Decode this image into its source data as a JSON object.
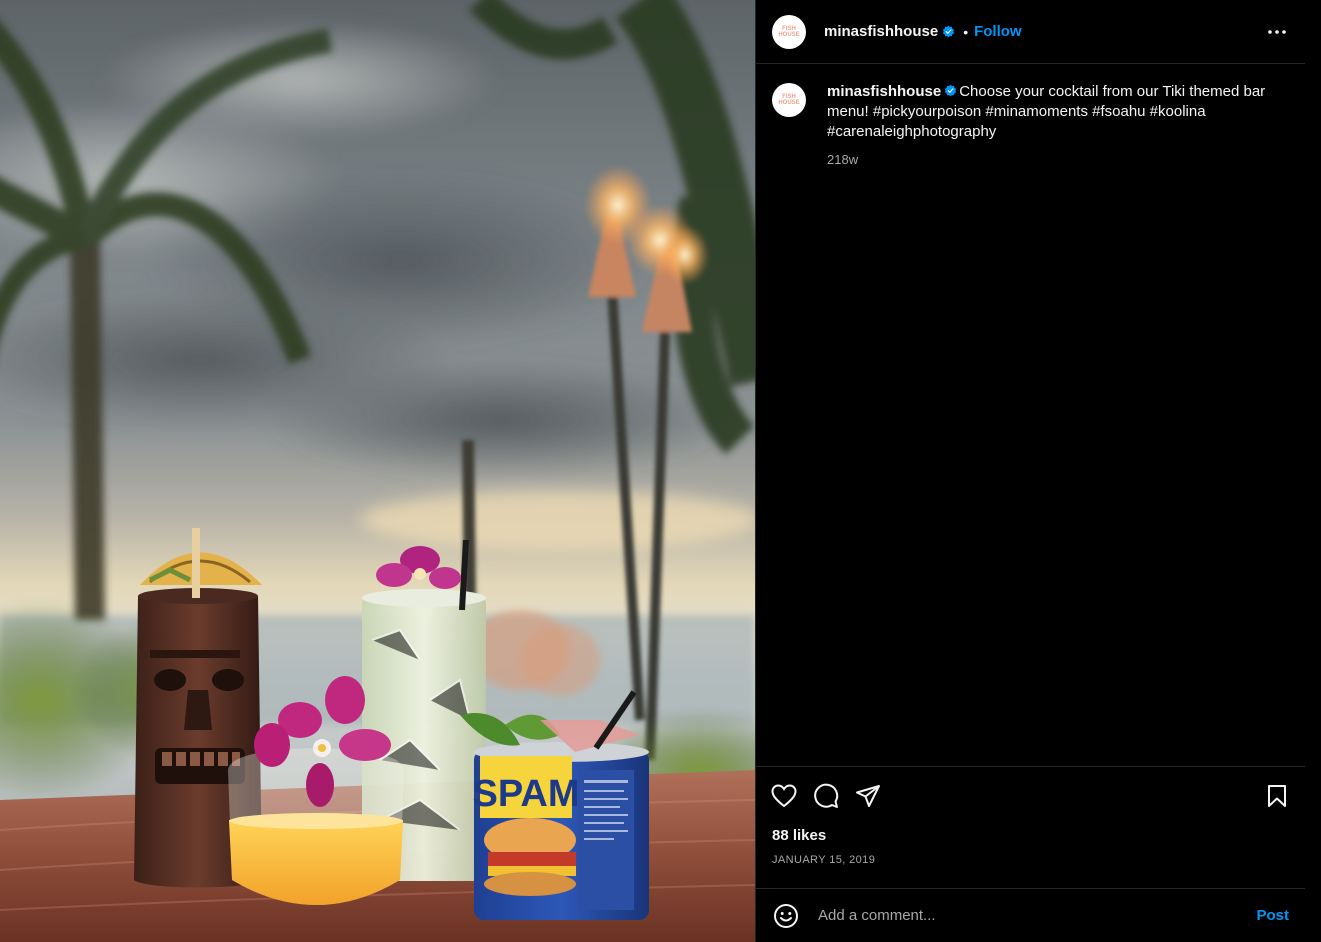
{
  "post": {
    "username": "minasfishhouse",
    "verified": true,
    "follow_label": "Follow",
    "separator": "•",
    "avatar_logo": "FISH HOUSE",
    "caption": {
      "username": "minasfishhouse",
      "text": "Choose your cocktail from our Tiki themed bar menu! #pickyourpoison #minamoments #fsoahu #koolina #carenaleighphotography",
      "time_ago": "218w"
    },
    "likes": "88 likes",
    "date": "JANUARY 15, 2019"
  },
  "photo": {
    "can_label": "SPAM",
    "description_icon": "cocktail-photo"
  },
  "comment_box": {
    "placeholder": "Add a comment...",
    "post_label": "Post"
  },
  "icons": {
    "more": "more-horizontal-icon",
    "like": "heart-icon",
    "comment": "comment-bubble-icon",
    "share": "paper-plane-icon",
    "save": "bookmark-icon",
    "emoji": "smiley-icon",
    "verified": "verified-badge-icon"
  },
  "colors": {
    "background": "#000000",
    "text": "#f5f5f5",
    "muted": "#a8a8a8",
    "accent": "#0095f6",
    "divider": "#262626"
  }
}
